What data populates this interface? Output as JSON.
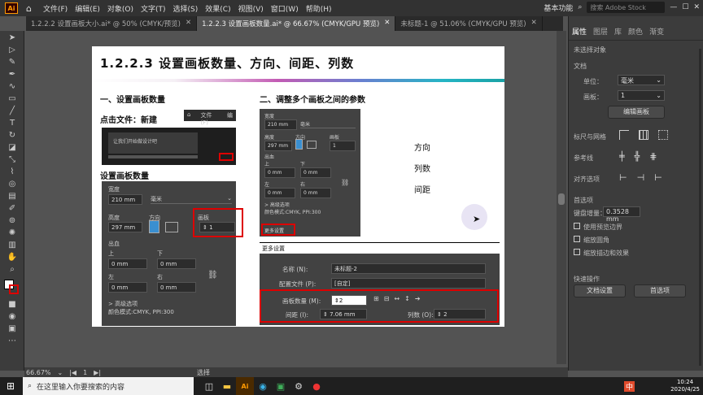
{
  "app": {
    "logo": "Ai",
    "home_icon": "home-icon"
  },
  "menu": [
    "文件(F)",
    "编辑(E)",
    "对象(O)",
    "文字(T)",
    "选择(S)",
    "效果(C)",
    "视图(V)",
    "窗口(W)",
    "帮助(H)"
  ],
  "workspace": "基本功能",
  "search_placeholder": "搜索 Adobe Stock",
  "tabs": [
    {
      "label": "1.2.2.2  设置画板大小.ai* @ 50% (CMYK/预览)"
    },
    {
      "label": "1.2.2.3  设置画板数量.ai* @ 66.67% (CMYK/GPU 预览)"
    },
    {
      "label": "未标题-1 @ 51.06% (CMYK/GPU 预览)"
    }
  ],
  "doc": {
    "title": "1.2.2.3 设置画板数量、方向、间距、列数",
    "section1": "一、设置画板数量",
    "click_file": "点击文件：新建",
    "set_count": "设置画板数量",
    "section2": "二、调整多个画板之间的参数",
    "labels": [
      "方向",
      "列数",
      "间距"
    ],
    "snippet_menu_home": "文件(F)",
    "snippet_menu_edit": "编",
    "panel1": {
      "width_label": "宽度",
      "width": "210 mm",
      "unit": "毫米",
      "height_label": "高度",
      "height": "297 mm",
      "orient_label": "方向",
      "artboard_label": "画板",
      "artboard": "1",
      "bleed": "出血",
      "top_label": "上",
      "bottom_label": "下",
      "left_label": "左",
      "right_label": "右",
      "zero": "0 mm",
      "advanced": "> 高级选项",
      "color": "颜色模式:CMYK, PPI:300"
    },
    "panel2": {
      "width_label": "宽度",
      "width": "210 mm",
      "unit": "毫米",
      "height_label": "高度",
      "height": "297 mm",
      "orient_label": "方向",
      "artboard_label": "画板",
      "artboard": "1",
      "bleed": "出血",
      "top_label": "上",
      "bottom_label": "下",
      "left_label": "左",
      "right_label": "右",
      "zero": "0 mm",
      "advanced": "> 高级选项",
      "color": "颜色模式:CMYK, PPI:300",
      "more": "更多设置"
    },
    "more_dialog": {
      "title": "更多设置",
      "name_label": "名称 (N):",
      "name": "未标题-2",
      "profile_label": "配置文件 (P):",
      "profile": "[自定]",
      "count_label": "画板数量 (M):",
      "count": "2",
      "spacing_label": "间距 (I):",
      "spacing": "7.06 mm",
      "cols_label": "列数 (O):",
      "cols": "2"
    },
    "snippet_text": "让我们开始做设计吧"
  },
  "panel": {
    "tabs": [
      "属性",
      "图层",
      "库",
      "颜色",
      "渐变"
    ],
    "no_selection": "未选择对象",
    "document": "文档",
    "unit_label": "单位：",
    "unit": "毫米",
    "artboard_label": "画板：",
    "artboard": "1",
    "edit_artboard": "编辑画板",
    "ruler_grid": "标尺与网格",
    "guides": "参考线",
    "snap": "对齐选项",
    "preferences": "首选项",
    "keyboard_inc_label": "键盘增量：",
    "keyboard_inc": "0.3528 mm",
    "opt1": "使用预览边界",
    "opt2": "缩放圆角",
    "opt3": "缩放描边和效果",
    "quick_actions": "快速操作",
    "doc_setup": "文档设置",
    "preferences_btn": "首选项"
  },
  "status": {
    "zoom": "66.67%",
    "page": "1",
    "tool": "选择"
  },
  "taskbar": {
    "search": "在这里输入你要搜索的内容",
    "time": "10:24",
    "date": "2020/4/25",
    "ime": "中"
  }
}
